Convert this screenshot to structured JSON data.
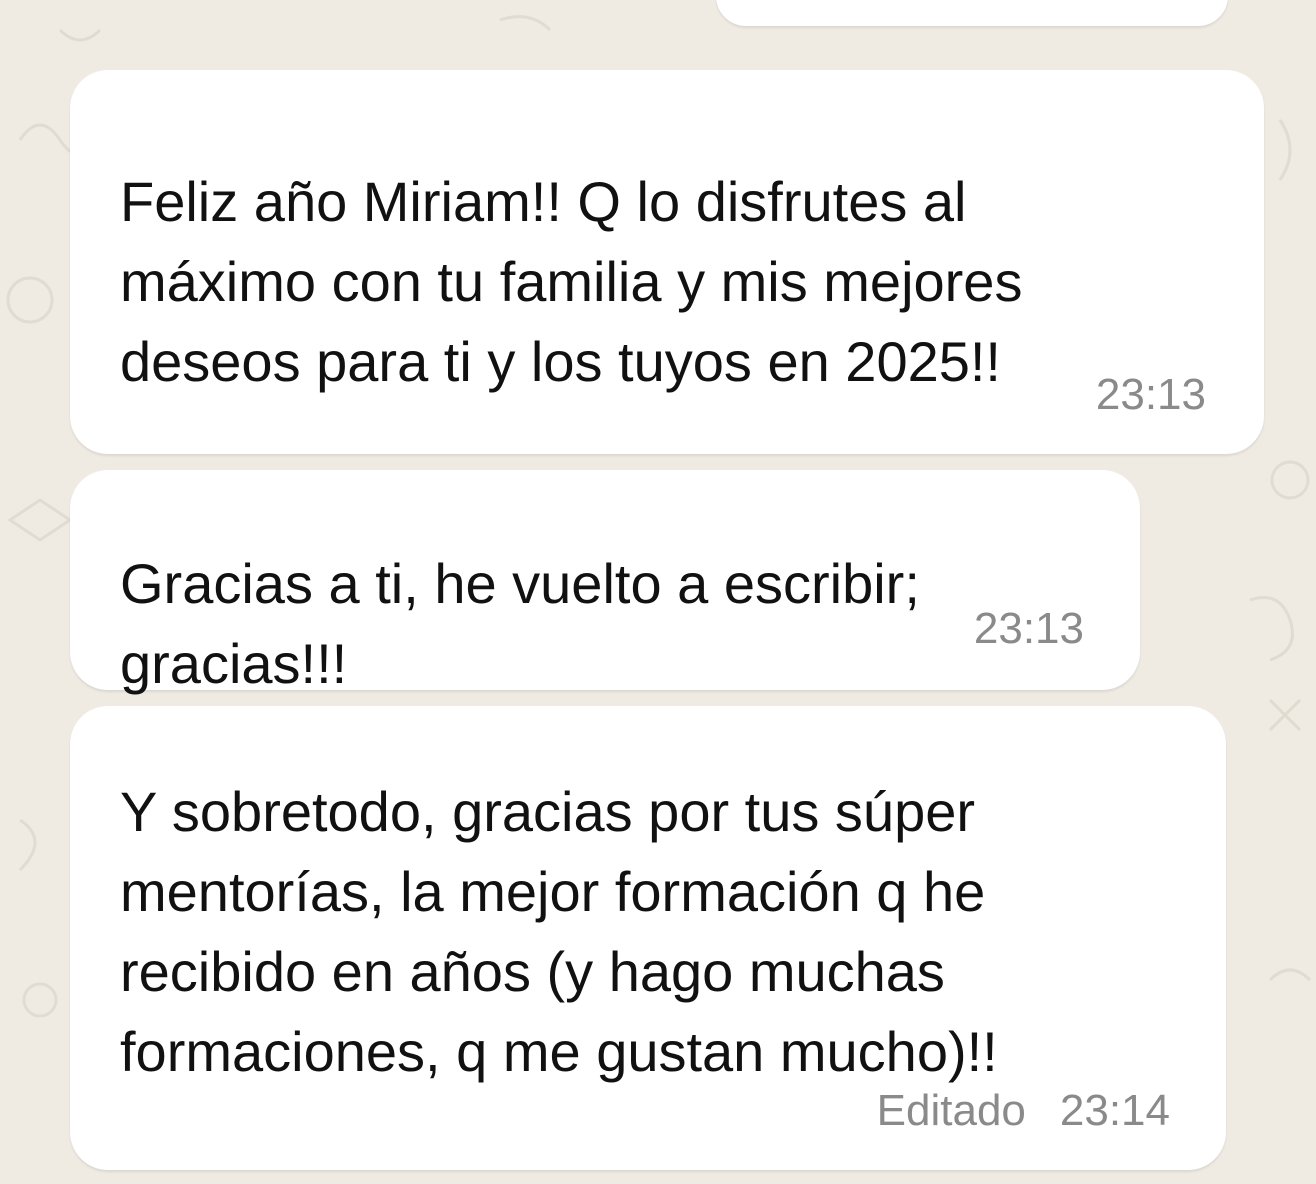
{
  "theme": {
    "background": "#efeae2",
    "bubble": "#ffffff",
    "text": "#111111",
    "meta": "#8a8a8a"
  },
  "messages": [
    {
      "lines": [
        "Feliz año Miriam!! Q lo disfrutes al",
        "máximo con tu familia y mis mejores",
        "deseos para ti y los tuyos en 2025!!"
      ],
      "time": "23:13"
    },
    {
      "lines": [
        "Gracias a ti, he vuelto a escribir;",
        "gracias!!!"
      ],
      "time": "23:13"
    },
    {
      "lines": [
        "Y sobretodo, gracias por tus súper",
        "mentorías, la mejor formación q he",
        "recibido en años (y hago muchas",
        "formaciones, q me gustan mucho)!!"
      ],
      "edited": "Editado",
      "time": "23:14"
    }
  ]
}
